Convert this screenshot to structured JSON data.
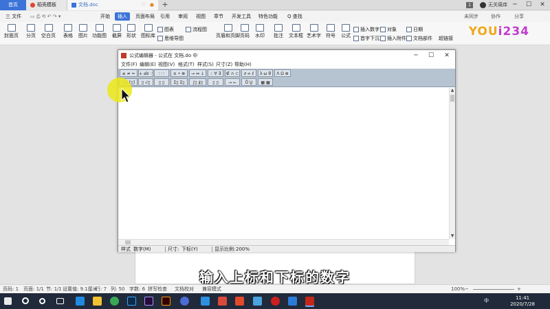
{
  "tabs": {
    "home": "首页",
    "templates": "稻壳模板",
    "doc": "文档.doc"
  },
  "topbar": {
    "user_badge": "1",
    "user_name": "无关痛痒"
  },
  "menubar": {
    "file": "三 文件",
    "items": [
      "开始",
      "插入",
      "页面布局",
      "引用",
      "审阅",
      "视图",
      "章节",
      "开发工具",
      "特色功能"
    ],
    "search": "Q 查找",
    "right": [
      "未同步",
      "协作",
      "分享"
    ]
  },
  "ribbon": {
    "large": [
      "封面页",
      "分页",
      "空白页",
      "表格",
      "图片",
      "功能图",
      "截屏",
      "形状",
      "图标库"
    ],
    "chart": "图表",
    "mindmap": "思维导图",
    "flowchart": "流程图",
    "header_footer": "页眉和页脚",
    "page_number": "页码",
    "watermark": "水印",
    "comment": "批注",
    "textbox": "文本框",
    "wordart": "艺术字",
    "symbol": "符号",
    "formula": "公式",
    "insert_number": "插入数字",
    "object": "对象",
    "drop_cap": "首字下沉",
    "insert_attachment": "插入附件",
    "date": "日期",
    "doc_parts": "文档部件",
    "hyperlink": "超链接"
  },
  "logo": {
    "text_a": "YOU",
    "text_b": "i234"
  },
  "equation_editor": {
    "title": "公式编辑器 - 公式在 文档.do 中",
    "menu": [
      "文件(F)",
      "编辑(E)",
      "视图(V)",
      "格式(T)",
      "样式(S)",
      "尺寸(Z)",
      "帮助(H)"
    ],
    "palette_row1": [
      "≤ ≠ ≈",
      "∔ ab ∵",
      "⫶ ⫶ ⫶",
      "± • ⊗",
      "→ ⇔ ↓",
      "∴ ∀ ∃",
      "∉ ∩ ⊂",
      "∂ ∞ ℓ",
      "λ ω θ",
      "Λ Ω ⊗"
    ],
    "palette_row2": [
      "(▯) [▯]",
      "▯ √▯",
      "▯ ▯",
      "Σ▯ Σ▯",
      "∫▯ ∮▯",
      "▯ ▯",
      "→ ←",
      "Ů Ų",
      "▦ ▦"
    ],
    "status": {
      "style_label": "样式",
      "style_value": "数字(M)",
      "size_label": "尺寸:",
      "size_value": "下标(Y)",
      "zoom_label": "显示比例:",
      "zoom_value": "200%"
    }
  },
  "caption": "输入上标和下标的数字",
  "wps_status": {
    "page": "页码: 1",
    "pages": "页面: 1/1",
    "section": "节: 1/1",
    "setting": "设置值: 9.1厘米",
    "row": "行: 7",
    "col": "列: 50",
    "chars": "字数: 6",
    "spellcheck": "拼写检查",
    "proofread": "文档校对",
    "compat": "兼容模式",
    "zoom": "100%"
  },
  "taskbar": {
    "time": "11:41",
    "date": "2020/7/28",
    "lang": "中"
  },
  "colors": {
    "accent": "#3b73d9",
    "palette_bg": "#b6c3d1",
    "taskbar": "#202a3a",
    "highlight": "#ece818"
  }
}
